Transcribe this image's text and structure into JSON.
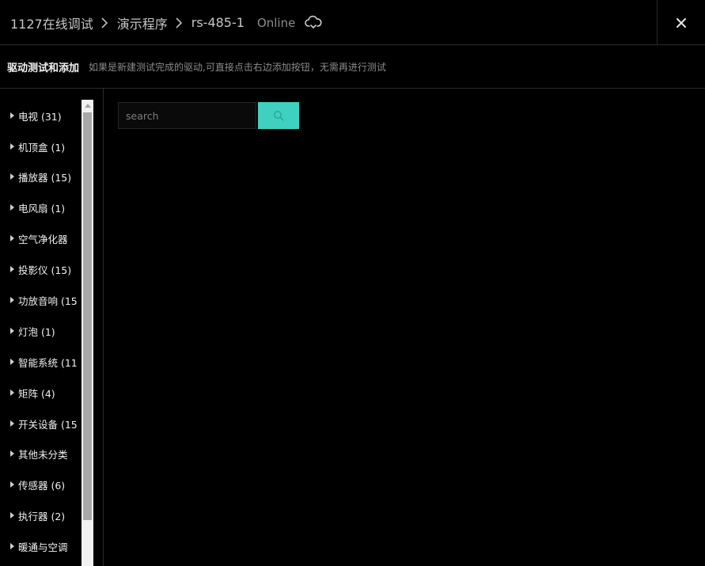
{
  "header": {
    "breadcrumbs": [
      "1127在线调试",
      "演示程序",
      "rs-485-1"
    ],
    "status": "Online",
    "status_icon": "cloud-icon",
    "close_icon": "close-icon"
  },
  "subheader": {
    "title": "驱动测试和添加",
    "description": "如果是新建测试完成的驱动,可直接点击右边添加按钮，无需再进行测试"
  },
  "sidebar": {
    "categories": [
      {
        "label": "电视 (31)"
      },
      {
        "label": "机顶盒 (1)"
      },
      {
        "label": "播放器 (15)"
      },
      {
        "label": "电风扇 (1)"
      },
      {
        "label": "空气净化器"
      },
      {
        "label": "投影仪 (15)"
      },
      {
        "label": "功放音响 (15"
      },
      {
        "label": "灯泡 (1)"
      },
      {
        "label": "智能系统 (11"
      },
      {
        "label": "矩阵 (4)"
      },
      {
        "label": "开关设备 (15"
      },
      {
        "label": "其他未分类"
      },
      {
        "label": "传感器 (6)"
      },
      {
        "label": "执行器 (2)"
      },
      {
        "label": "暖通与空调"
      }
    ]
  },
  "search": {
    "placeholder": "search",
    "value": "",
    "button_icon": "search-icon"
  },
  "colors": {
    "background": "#000000",
    "accent": "#3fd0c0",
    "border": "#2a2a2a"
  }
}
